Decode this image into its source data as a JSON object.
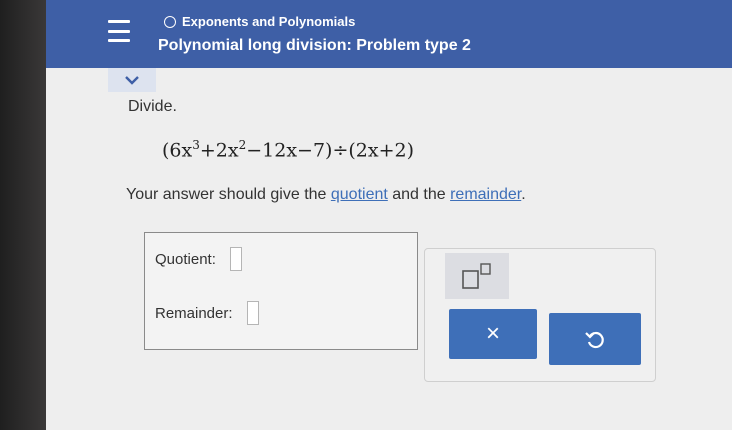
{
  "header": {
    "topic": "Exponents and Polynomials",
    "problem_title": "Polynomial long division: Problem type 2"
  },
  "problem": {
    "prompt": "Divide.",
    "expression": {
      "open": "(6x",
      "exp1": "3",
      "mid1": "+2x",
      "exp2": "2",
      "mid2": "−12x−7)÷(2x+2)"
    },
    "instruction": {
      "before": "Your answer should give the ",
      "link1": "quotient",
      "middle": " and the ",
      "link2": "remainder",
      "after": "."
    }
  },
  "answer": {
    "quotient_label": "Quotient:",
    "remainder_label": "Remainder:"
  },
  "tools": {
    "clear_label": "×"
  },
  "colors": {
    "header": "#3e5fa6",
    "button": "#3e6fb8",
    "link": "#3e6fb8"
  },
  "icons": [
    "menu-icon",
    "circle-icon",
    "chevron-down-icon",
    "exponent-icon",
    "undo-icon"
  ]
}
